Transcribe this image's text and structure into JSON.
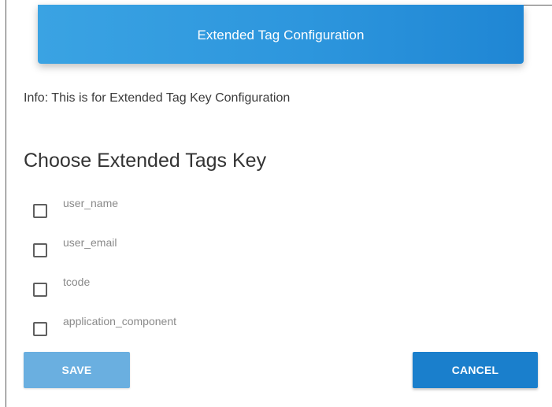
{
  "header": {
    "title": "Extended Tag Configuration"
  },
  "info": {
    "text": "Info: This is for Extended Tag Key Configuration"
  },
  "section": {
    "title": "Choose Extended Tags Key"
  },
  "options": [
    {
      "label": "user_name",
      "checked": false
    },
    {
      "label": "user_email",
      "checked": false
    },
    {
      "label": "tcode",
      "checked": false
    },
    {
      "label": "application_component",
      "checked": false
    }
  ],
  "actions": {
    "save_label": "SAVE",
    "cancel_label": "CANCEL",
    "save_enabled": false
  },
  "colors": {
    "header_gradient_start": "#3aa3e3",
    "header_gradient_end": "#1f86d4",
    "save_disabled": "#6aafe0",
    "cancel": "#1a7fcc"
  }
}
